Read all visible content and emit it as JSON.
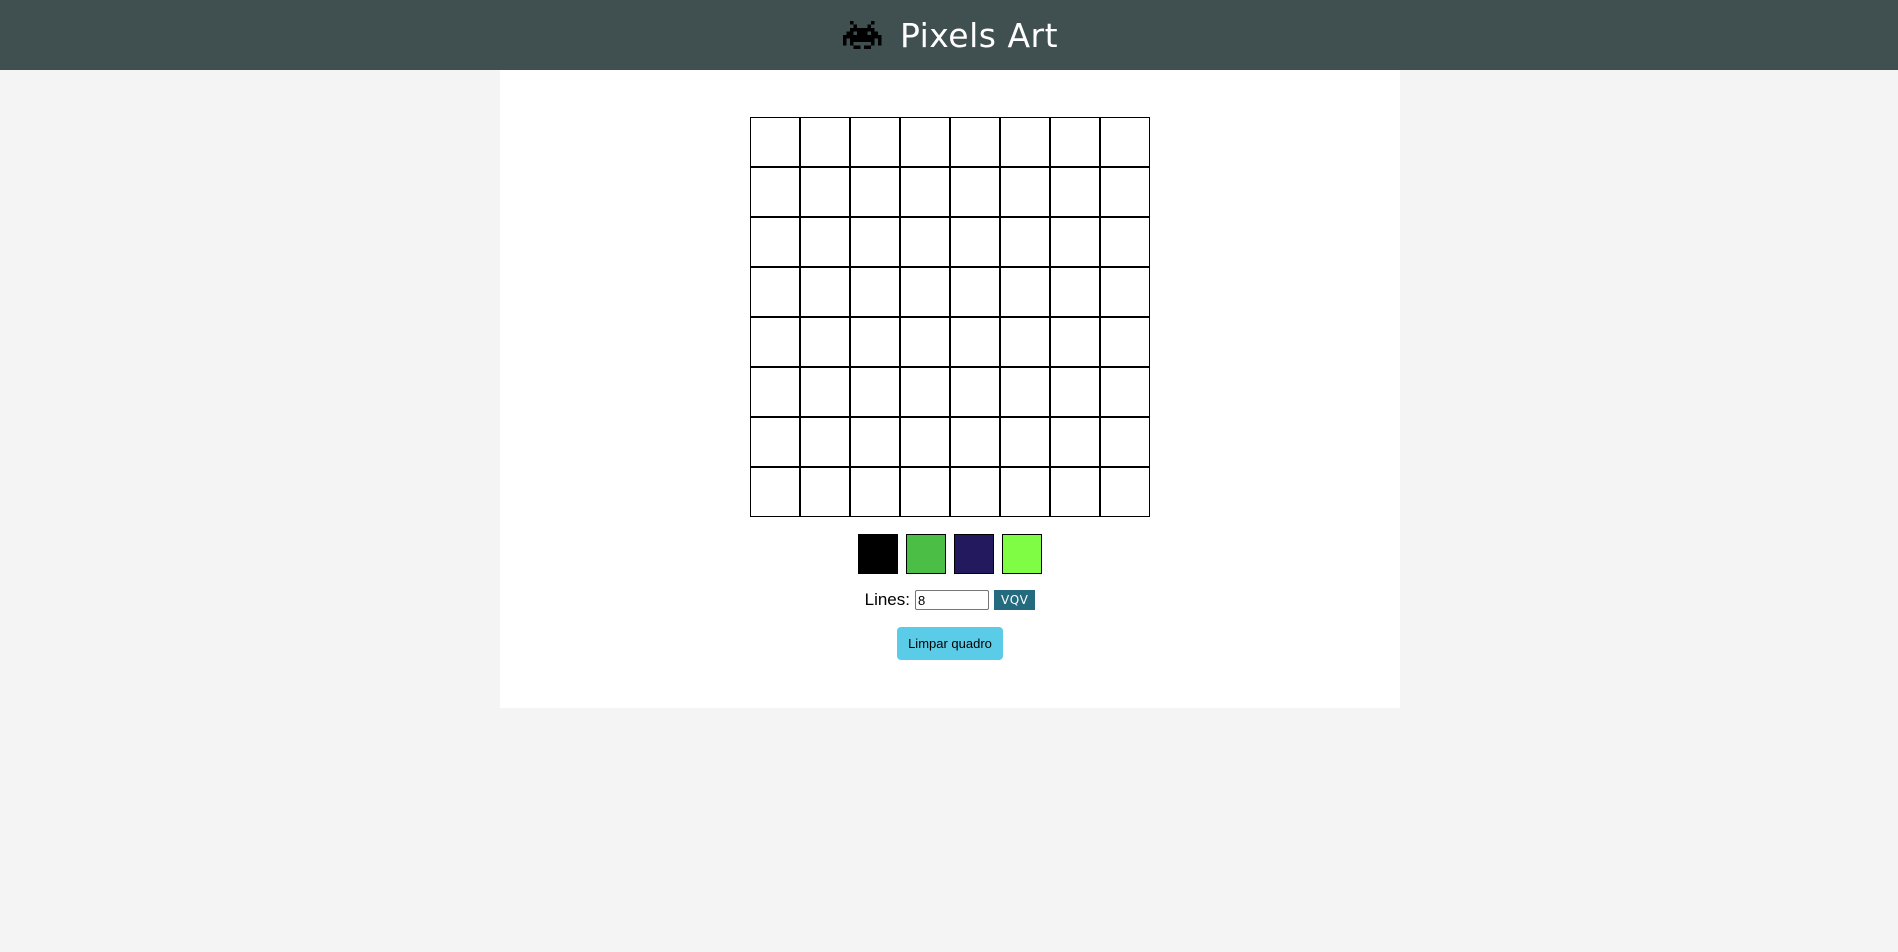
{
  "header": {
    "title": "Pixels Art",
    "logo_icon": "space-invader-icon"
  },
  "board": {
    "rows": 8,
    "columns": 8
  },
  "palette": {
    "colors": [
      "#000000",
      "#4bbe46",
      "#23195f",
      "#7efd44"
    ]
  },
  "controls": {
    "lines_label": "Lines:",
    "lines_value": "8",
    "generate_label": "VQV",
    "clear_label": "Limpar quadro"
  }
}
